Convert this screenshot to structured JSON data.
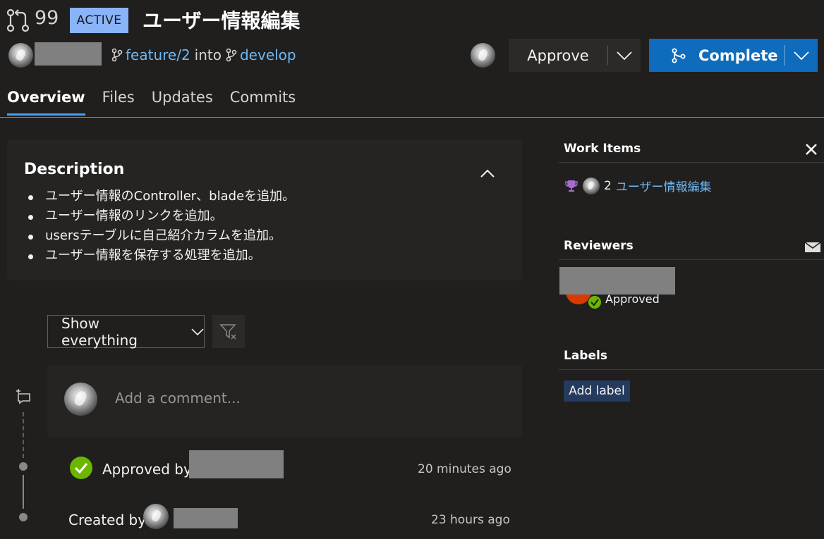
{
  "header": {
    "pr_number": "99",
    "status": "ACTIVE",
    "title": "ユーザー情報編集",
    "source_branch": "feature/2",
    "into_label": "into",
    "target_branch": "develop",
    "approve_label": "Approve",
    "complete_label": "Complete"
  },
  "tabs": [
    {
      "label": "Overview",
      "active": true
    },
    {
      "label": "Files",
      "active": false
    },
    {
      "label": "Updates",
      "active": false
    },
    {
      "label": "Commits",
      "active": false
    }
  ],
  "description": {
    "title": "Description",
    "items": [
      "ユーザー情報のController、bladeを追加。",
      "ユーザー情報のリンクを追加。",
      "usersテーブルに自己紹介カラムを追加。",
      "ユーザー情報を保存する処理を追加。"
    ]
  },
  "filter": {
    "selected": "Show everything"
  },
  "comment": {
    "placeholder": "Add a comment..."
  },
  "timeline": [
    {
      "text": "Approved by",
      "time": "20 minutes ago"
    },
    {
      "text": "Created by",
      "time": "23 hours ago"
    }
  ],
  "side_panel": {
    "work_items_title": "Work Items",
    "work_item_id": "2",
    "work_item_title": "ユーザー情報編集",
    "reviewers_title": "Reviewers",
    "reviewer_status": "Approved",
    "labels_title": "Labels",
    "add_label": "Add label"
  },
  "colors": {
    "background": "#201f1e",
    "accent": "#0f6cbd",
    "status_badge": "#8ab4f8",
    "link": "#6cb8f6",
    "approved": "#6bb700"
  },
  "icons": [
    "pull-request-icon",
    "branch-icon",
    "chevron-down-icon",
    "chevron-up-icon",
    "merge-icon",
    "filter-clear-icon",
    "comment-add-icon",
    "check-circle-icon",
    "close-icon",
    "mail-icon",
    "trophy-icon"
  ]
}
